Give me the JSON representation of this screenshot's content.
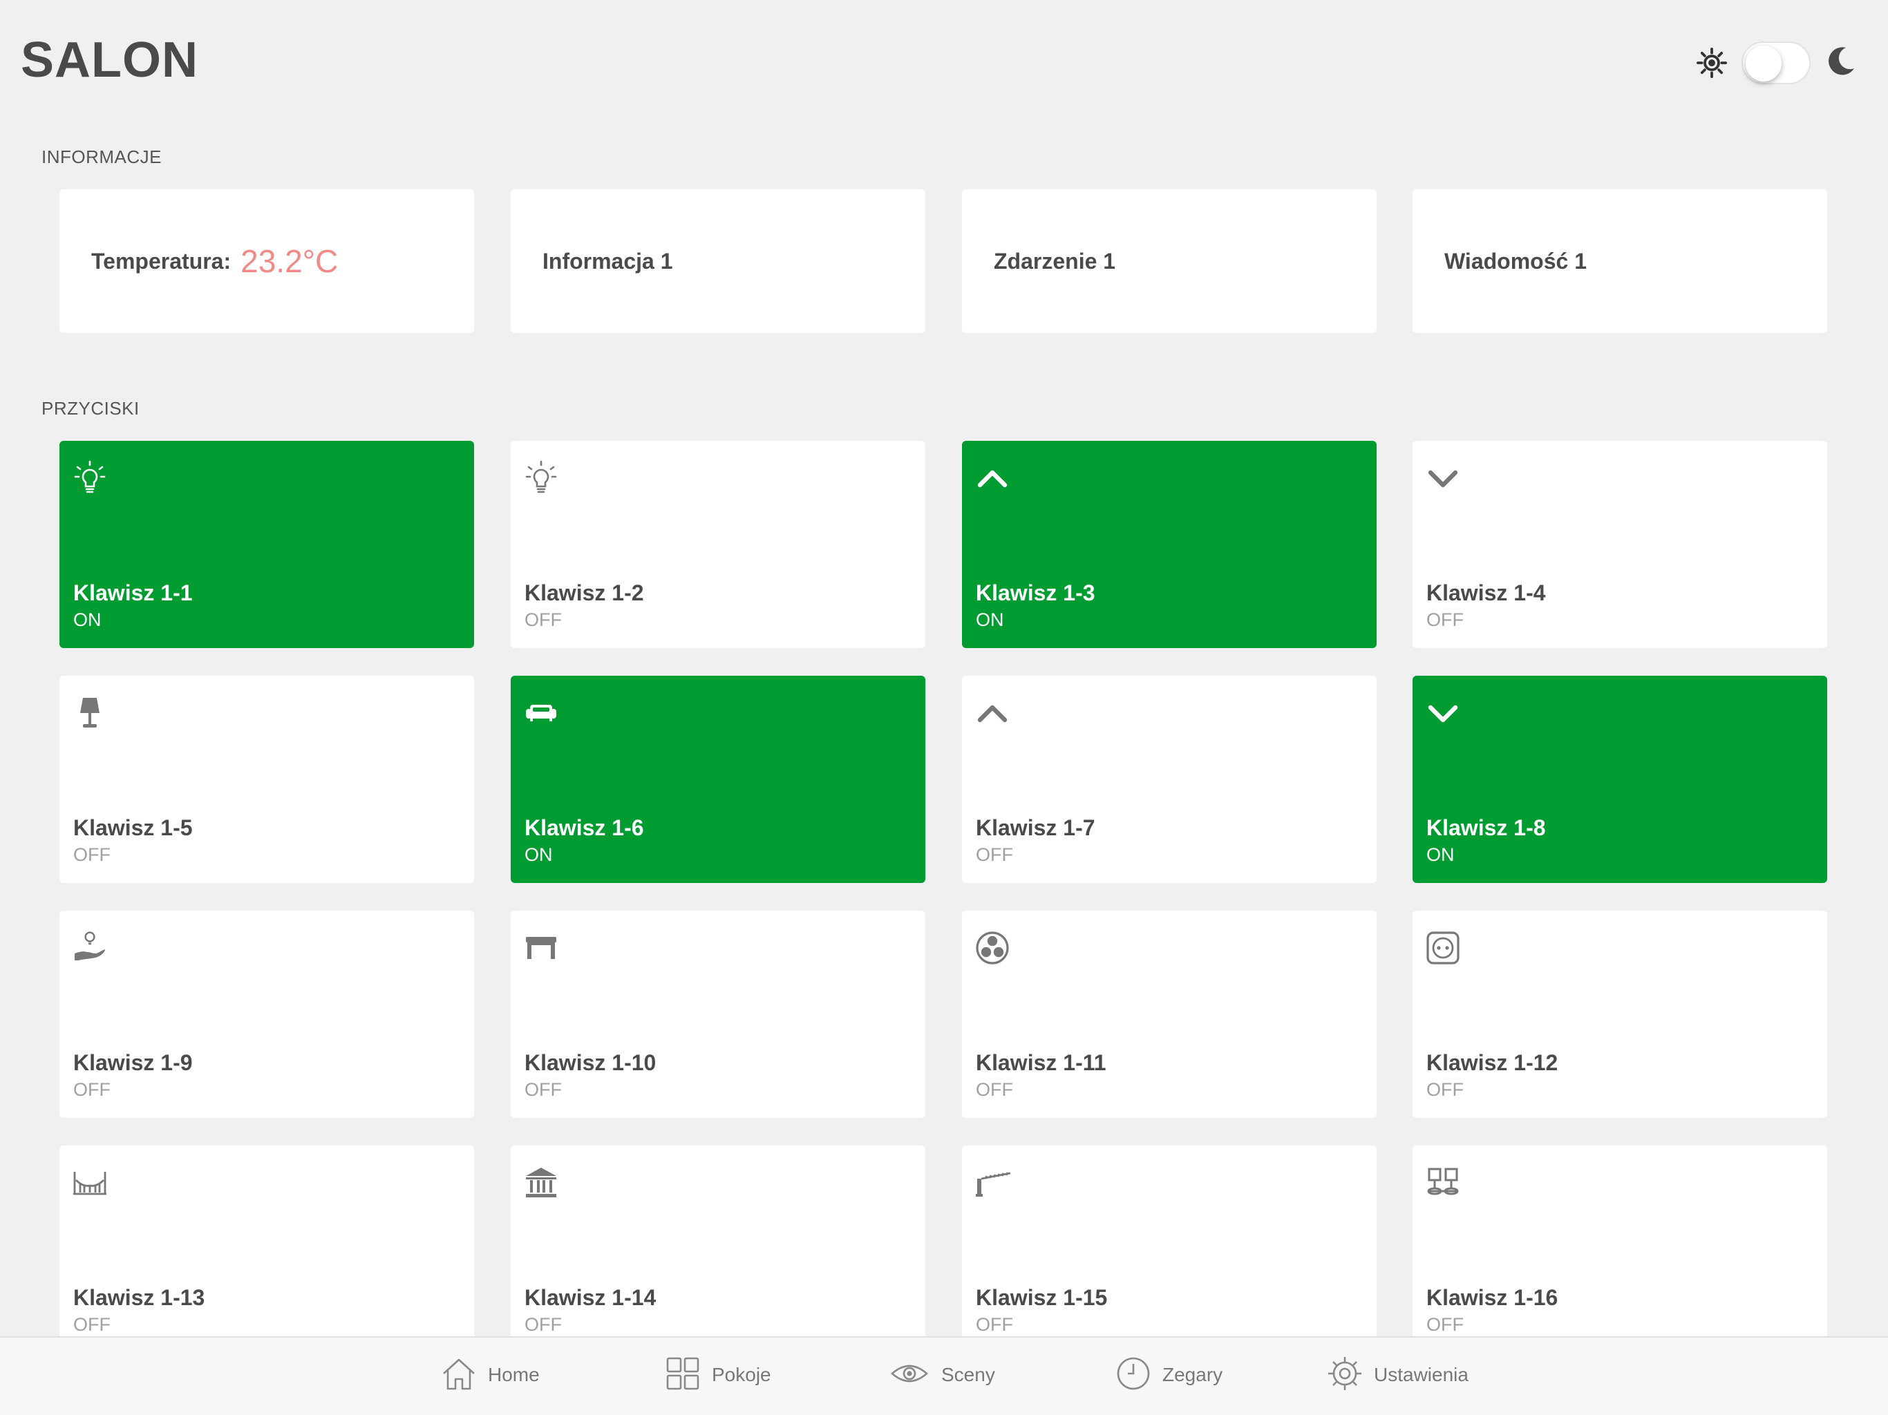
{
  "header": {
    "title": "SALON"
  },
  "sections": {
    "info": "INFORMACJE",
    "buttons": "PRZYCISKI"
  },
  "info_cards": [
    {
      "label": "Temperatura:",
      "value": "23.2°C"
    },
    {
      "label": "Informacja 1"
    },
    {
      "label": "Zdarzenie 1"
    },
    {
      "label": "Wiadomość 1"
    }
  ],
  "buttons": [
    {
      "label": "Klawisz 1-1",
      "state": "ON",
      "icon": "bulb-icon"
    },
    {
      "label": "Klawisz 1-2",
      "state": "OFF",
      "icon": "bulb-icon"
    },
    {
      "label": "Klawisz 1-3",
      "state": "ON",
      "icon": "chevron-up-icon"
    },
    {
      "label": "Klawisz 1-4",
      "state": "OFF",
      "icon": "chevron-down-icon"
    },
    {
      "label": "Klawisz 1-5",
      "state": "OFF",
      "icon": "table-lamp-icon"
    },
    {
      "label": "Klawisz 1-6",
      "state": "ON",
      "icon": "sofa-icon"
    },
    {
      "label": "Klawisz 1-7",
      "state": "OFF",
      "icon": "chevron-up-icon"
    },
    {
      "label": "Klawisz 1-8",
      "state": "ON",
      "icon": "chevron-down-icon"
    },
    {
      "label": "Klawisz 1-9",
      "state": "OFF",
      "icon": "hand-bulb-icon"
    },
    {
      "label": "Klawisz 1-10",
      "state": "OFF",
      "icon": "table-icon"
    },
    {
      "label": "Klawisz 1-11",
      "state": "OFF",
      "icon": "fan-icon"
    },
    {
      "label": "Klawisz 1-12",
      "state": "OFF",
      "icon": "socket-icon"
    },
    {
      "label": "Klawisz 1-13",
      "state": "OFF",
      "icon": "gate-icon"
    },
    {
      "label": "Klawisz 1-14",
      "state": "OFF",
      "icon": "building-icon"
    },
    {
      "label": "Klawisz 1-15",
      "state": "OFF",
      "icon": "barrier-icon"
    },
    {
      "label": "Klawisz 1-16",
      "state": "OFF",
      "icon": "scenes-grid-icon"
    }
  ],
  "nav": [
    {
      "label": "Home",
      "icon": "home-icon"
    },
    {
      "label": "Pokoje",
      "icon": "rooms-grid-icon"
    },
    {
      "label": "Sceny",
      "icon": "eye-icon"
    },
    {
      "label": "Zegary",
      "icon": "clock-icon"
    },
    {
      "label": "Ustawienia",
      "icon": "gear-icon"
    }
  ],
  "theme": {
    "mode": "light",
    "sun_icon": "sun-icon",
    "moon_icon": "moon-icon"
  },
  "colors": {
    "on": "#009b31",
    "temperature": "#f28a87",
    "background": "#f0f0f0"
  }
}
